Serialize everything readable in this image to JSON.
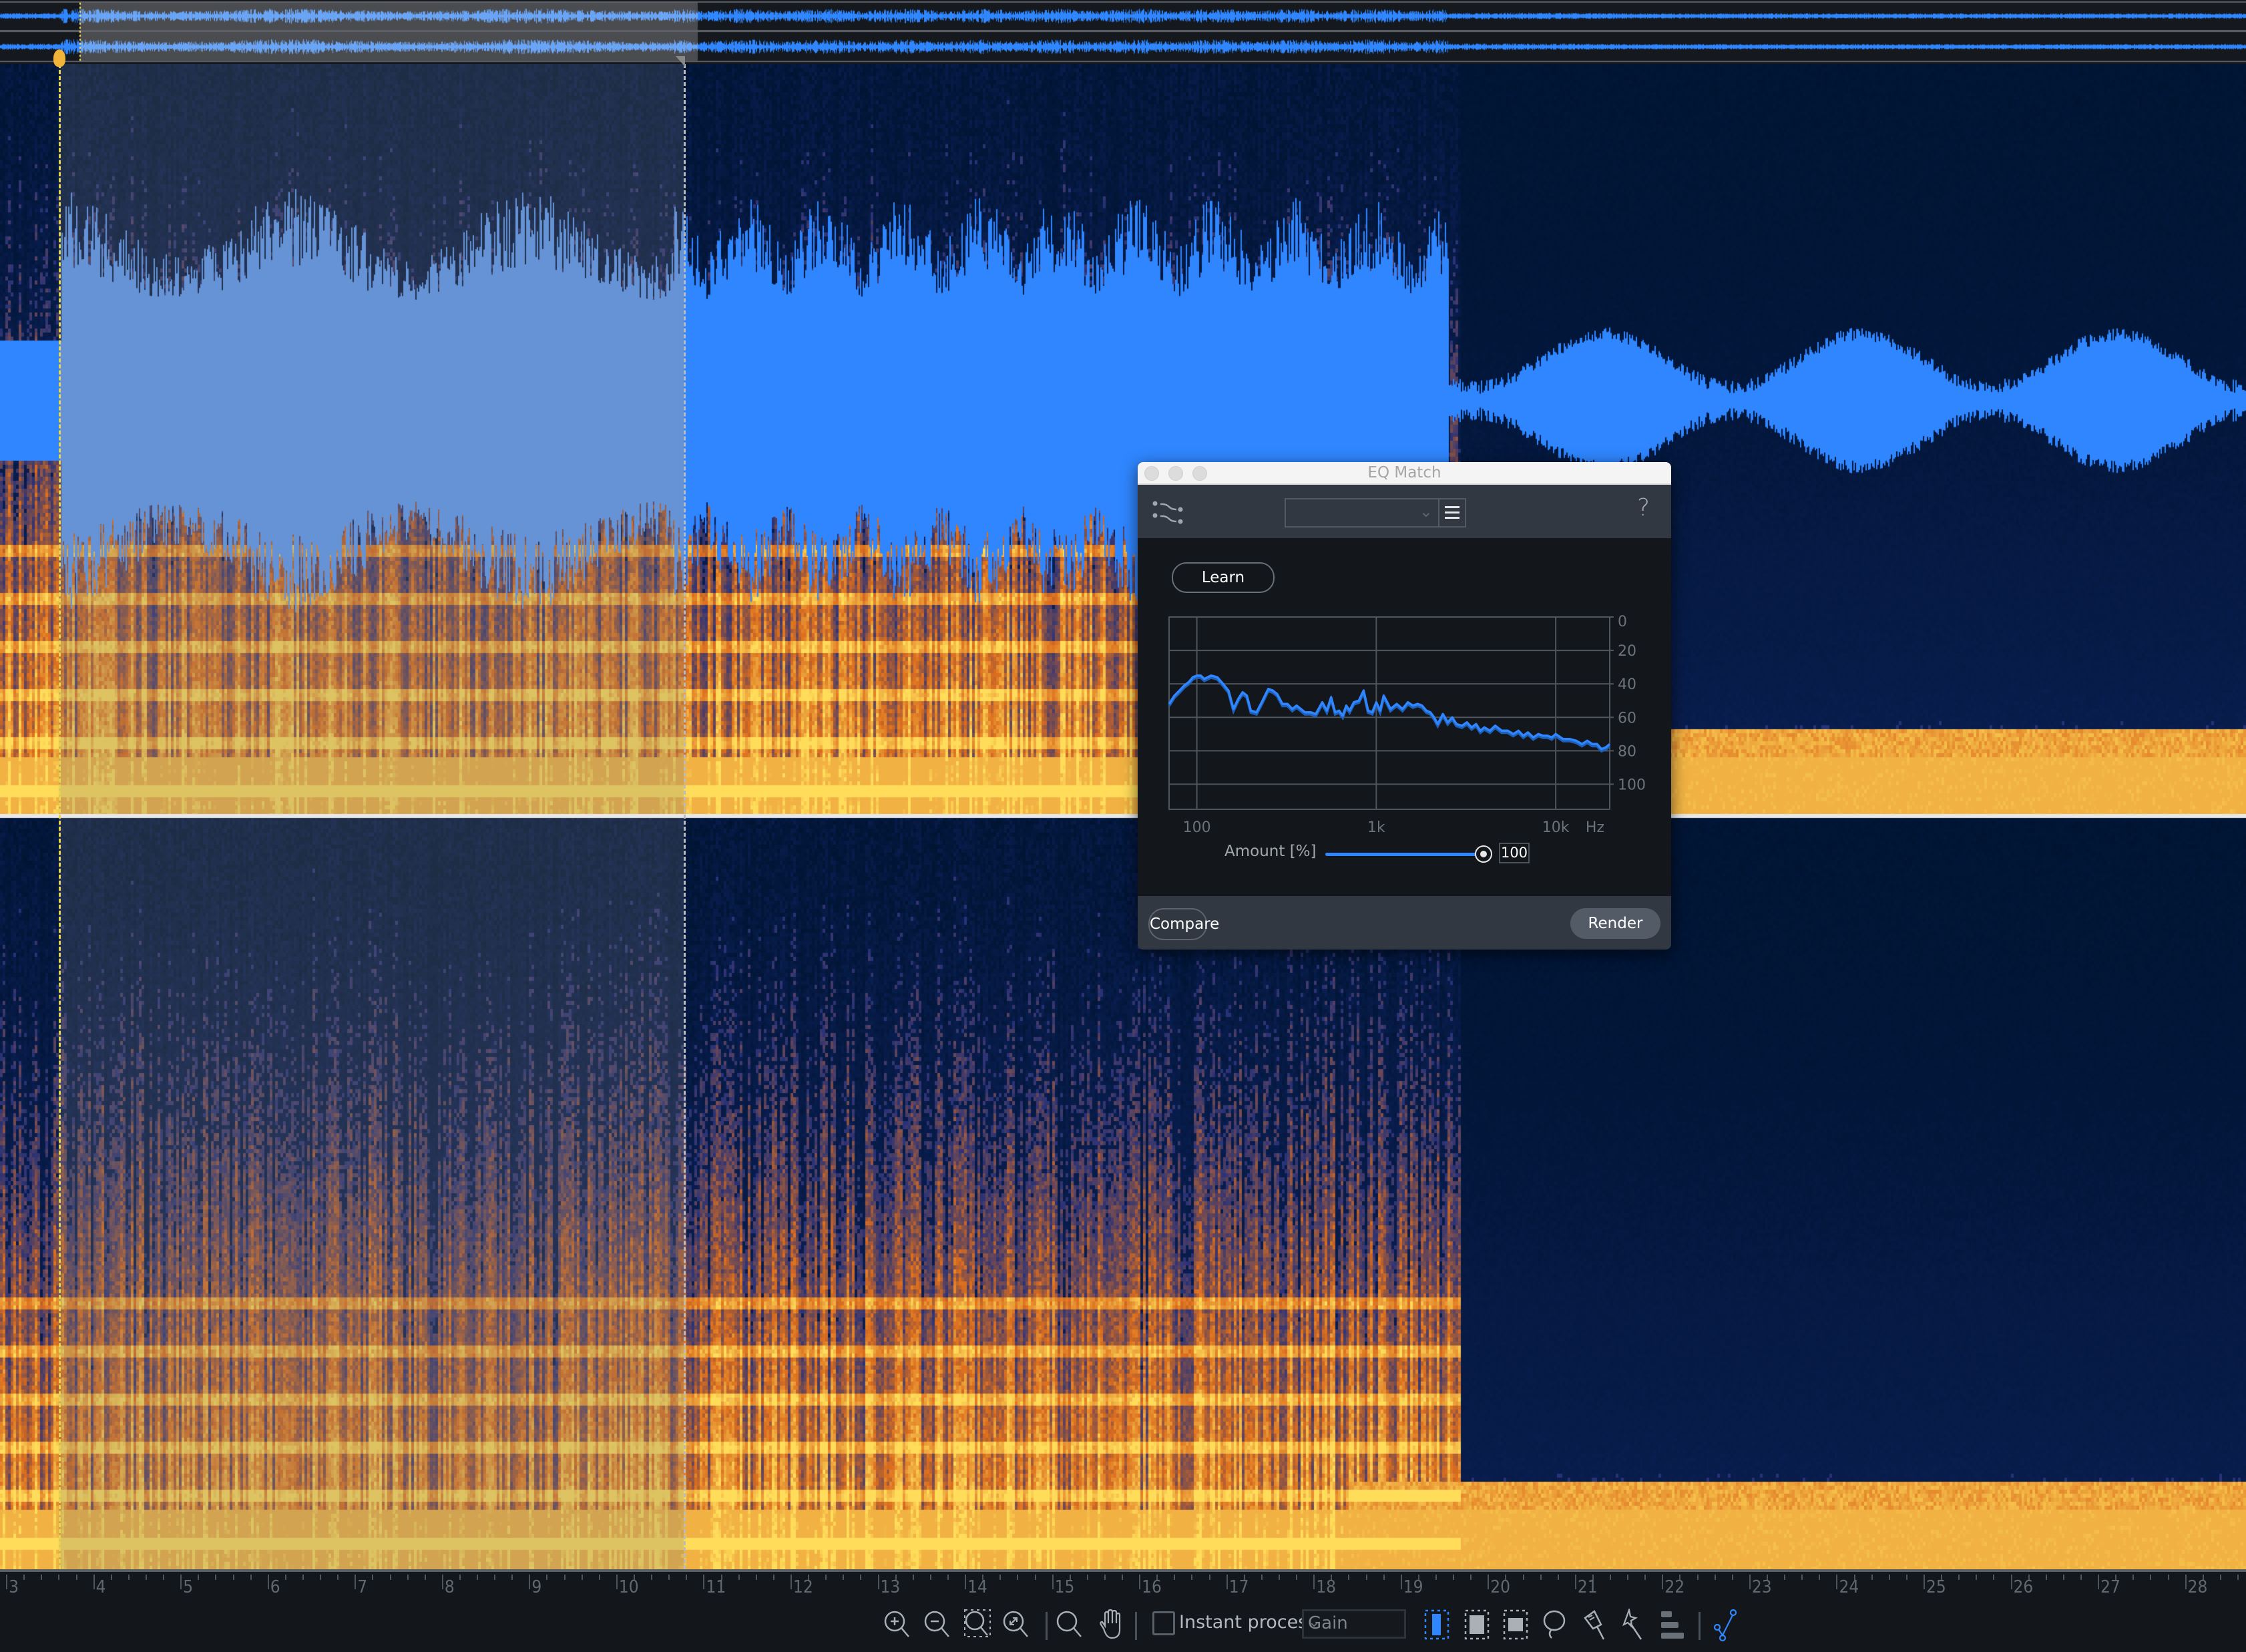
{
  "overview": {
    "label": "waveform-overview",
    "selection_start_s": 3.7,
    "selection_end_s": 10.8
  },
  "timeline": {
    "labels": [
      "3",
      "4",
      "5",
      "6",
      "7",
      "8",
      "9",
      "10",
      "11",
      "12",
      "13",
      "14",
      "15",
      "16",
      "17",
      "18",
      "19",
      "20",
      "21",
      "22",
      "23",
      "24",
      "25",
      "26",
      "27",
      "28"
    ],
    "start_s": 2.93,
    "end_s": 28.7,
    "selection_start_s": 3.7,
    "selection_end_s": 10.8
  },
  "colors": {
    "waveform": "#2f86ff",
    "waveform_light": "#5b9df5",
    "spectrogram_hot": "#ffb640",
    "spectrogram_cool": "#102040",
    "accent": "#2f86ff",
    "playhead": "#f0b43a"
  },
  "dialog": {
    "title": "EQ Match",
    "preset_value": "",
    "help_label": "?",
    "learn_label": "Learn",
    "amount_label": "Amount [%]",
    "amount_value": "100",
    "amount_fraction": 1.0,
    "compare_label": "Compare",
    "render_label": "Render",
    "icons": {
      "module": "eq-match-icon",
      "menu": "hamburger-menu-icon",
      "help": "help-icon",
      "chevron": "chevron-down-icon"
    }
  },
  "chart_data": {
    "type": "line",
    "title": "",
    "xlabel": "Hz",
    "ylabel": "",
    "xscale": "log",
    "xlim": [
      70,
      20000
    ],
    "ylim": [
      0,
      115
    ],
    "y_inverted": true,
    "x_ticks": [
      {
        "value": 100,
        "label": "100"
      },
      {
        "value": 1000,
        "label": "1k"
      },
      {
        "value": 10000,
        "label": "10k"
      }
    ],
    "x_unit_label": "Hz",
    "y_ticks": [
      0,
      20,
      40,
      60,
      80,
      100
    ],
    "grid": true,
    "series": [
      {
        "name": "spectrum",
        "x": [
          70,
          75,
          80,
          85,
          90,
          95,
          100,
          105,
          110,
          120,
          130,
          140,
          150,
          160,
          170,
          180,
          190,
          200,
          215,
          230,
          250,
          265,
          280,
          300,
          320,
          340,
          360,
          380,
          400,
          430,
          460,
          500,
          530,
          560,
          590,
          620,
          650,
          680,
          710,
          750,
          800,
          850,
          900,
          950,
          1000,
          1050,
          1100,
          1150,
          1200,
          1300,
          1400,
          1500,
          1600,
          1700,
          1800,
          1900,
          2000,
          2100,
          2200,
          2350,
          2500,
          2650,
          2800,
          3000,
          3200,
          3400,
          3600,
          3800,
          4000,
          4300,
          4600,
          5000,
          5400,
          5800,
          6200,
          6600,
          7000,
          7500,
          8000,
          8500,
          9000,
          9500,
          10000,
          11000,
          12000,
          13000,
          14000,
          15000,
          16000,
          17000,
          18000,
          19000,
          20000
        ],
        "y": [
          52,
          47,
          44,
          41,
          39,
          36,
          35,
          35,
          37,
          35,
          36,
          40,
          44,
          55,
          49,
          45,
          47,
          56,
          57,
          51,
          43,
          44,
          46,
          52,
          52,
          55,
          53,
          55,
          57,
          57,
          58,
          51,
          56,
          48,
          57,
          56,
          59,
          53,
          56,
          51,
          50,
          44,
          56,
          57,
          51,
          56,
          47,
          51,
          55,
          52,
          55,
          51,
          53,
          52,
          53,
          56,
          57,
          60,
          64,
          58,
          63,
          60,
          64,
          65,
          63,
          66,
          64,
          68,
          66,
          68,
          65,
          68,
          68,
          70,
          68,
          71,
          69,
          72,
          70,
          71,
          71,
          72,
          70,
          73,
          73,
          74,
          76,
          74,
          76,
          76,
          79,
          78,
          76
        ]
      }
    ]
  },
  "toolbar": {
    "items": [
      {
        "name": "zoom-in-icon"
      },
      {
        "name": "zoom-out-icon"
      },
      {
        "name": "zoom-selection-icon"
      },
      {
        "name": "zoom-fit-icon"
      },
      {
        "name": "zoom-tool-icon"
      },
      {
        "name": "hand-tool-icon"
      }
    ],
    "instant_process_label": "Instant process",
    "instant_process_checked": false,
    "gain_select_value": "Gain",
    "selection_tools": [
      "time-selection-icon",
      "frequency-selection-icon",
      "time-frequency-selection-icon",
      "lasso-icon",
      "brush-icon",
      "magic-wand-icon",
      "harmonic-selection-icon"
    ],
    "active_tool": "time-selection-icon",
    "waveform_toggle": "waveform-spectrogram-icon"
  }
}
